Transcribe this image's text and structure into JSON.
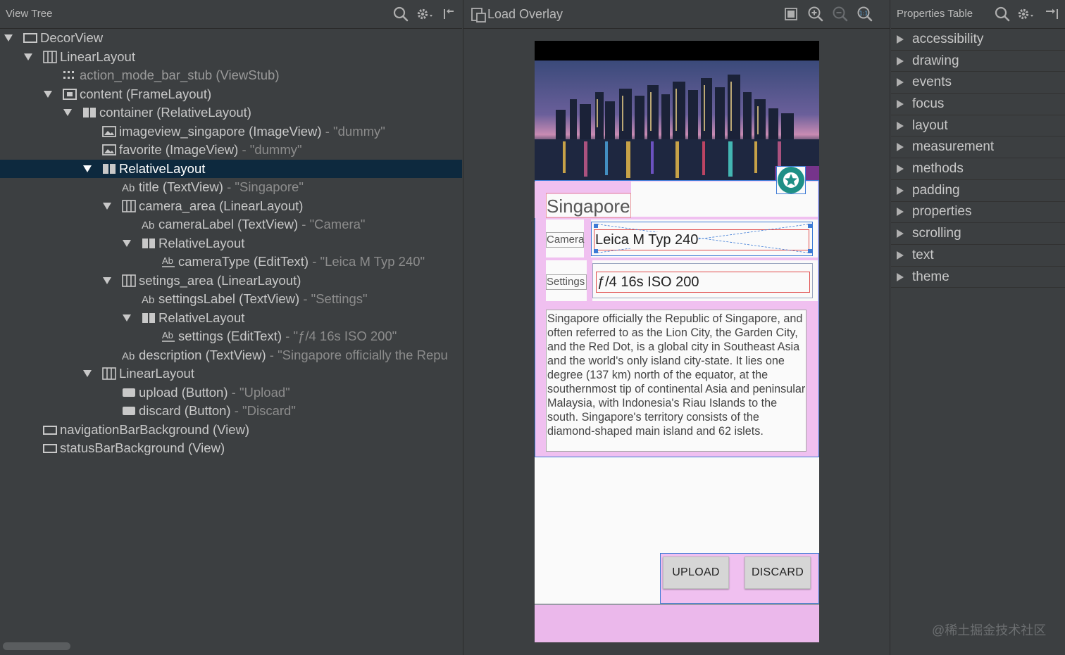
{
  "left_panel": {
    "title": "View Tree",
    "tree": [
      {
        "name": "DecorView",
        "value": "",
        "expanded": true,
        "selected": false,
        "icon": "frame-icon"
      },
      {
        "name": "LinearLayout",
        "value": "",
        "expanded": true,
        "selected": false,
        "icon": "linear-layout-icon"
      },
      {
        "name": "action_mode_bar_stub (ViewStub)",
        "value": "",
        "expanded": null,
        "selected": false,
        "icon": "viewstub-icon",
        "dim": true
      },
      {
        "name": "content (FrameLayout)",
        "value": "",
        "expanded": true,
        "selected": false,
        "icon": "framelayout-icon"
      },
      {
        "name": "container (RelativeLayout)",
        "value": "",
        "expanded": true,
        "selected": false,
        "icon": "relative-layout-icon"
      },
      {
        "name": "imageview_singapore (ImageView)",
        "value": "\"dummy\"",
        "expanded": null,
        "selected": false,
        "icon": "image-icon"
      },
      {
        "name": "favorite (ImageView)",
        "value": "\"dummy\"",
        "expanded": null,
        "selected": false,
        "icon": "image-icon"
      },
      {
        "name": "RelativeLayout",
        "value": "",
        "expanded": true,
        "selected": true,
        "icon": "relative-layout-icon"
      },
      {
        "name": "title (TextView)",
        "value": "\"Singapore\"",
        "expanded": null,
        "selected": false,
        "icon": "textview-icon"
      },
      {
        "name": "camera_area (LinearLayout)",
        "value": "",
        "expanded": true,
        "selected": false,
        "icon": "linear-layout-icon"
      },
      {
        "name": "cameraLabel (TextView)",
        "value": "\"Camera\"",
        "expanded": null,
        "selected": false,
        "icon": "textview-icon"
      },
      {
        "name": "RelativeLayout",
        "value": "",
        "expanded": true,
        "selected": false,
        "icon": "relative-layout-icon"
      },
      {
        "name": "cameraType (EditText)",
        "value": "\"Leica M Typ 240\"",
        "expanded": null,
        "selected": false,
        "icon": "edittext-icon"
      },
      {
        "name": "setings_area (LinearLayout)",
        "value": "",
        "expanded": true,
        "selected": false,
        "icon": "linear-layout-icon"
      },
      {
        "name": "settingsLabel (TextView)",
        "value": "\"Settings\"",
        "expanded": null,
        "selected": false,
        "icon": "textview-icon"
      },
      {
        "name": "RelativeLayout",
        "value": "",
        "expanded": true,
        "selected": false,
        "icon": "relative-layout-icon"
      },
      {
        "name": "settings (EditText)",
        "value": "\"ƒ/4 16s ISO 200\"",
        "expanded": null,
        "selected": false,
        "icon": "edittext-icon"
      },
      {
        "name": "description (TextView)",
        "value": "\"Singapore officially the Repu",
        "expanded": null,
        "selected": false,
        "icon": "textview-icon"
      },
      {
        "name": "LinearLayout",
        "value": "",
        "expanded": true,
        "selected": false,
        "icon": "linear-layout-icon"
      },
      {
        "name": "upload (Button)",
        "value": "\"Upload\"",
        "expanded": null,
        "selected": false,
        "icon": "button-icon"
      },
      {
        "name": "discard (Button)",
        "value": "\"Discard\"",
        "expanded": null,
        "selected": false,
        "icon": "button-icon"
      },
      {
        "name": "navigationBarBackground (View)",
        "value": "",
        "expanded": null,
        "selected": false,
        "icon": "view-icon"
      },
      {
        "name": "statusBarBackground (View)",
        "value": "",
        "expanded": null,
        "selected": false,
        "icon": "view-icon"
      }
    ]
  },
  "middle_panel": {
    "title": "Load Overlay",
    "device": {
      "title": "Singapore",
      "camera_label": "Camera",
      "camera_value": "Leica M Typ 240",
      "settings_label": "Settings",
      "settings_value": "ƒ/4 16s ISO 200",
      "description": "Singapore officially the Republic of Singapore, and often referred to as the Lion City, the Garden City, and the Red Dot, is a global city in Southeast Asia and the world's only island city-state. It lies one degree (137 km) north of the equator, at the southernmost tip of continental Asia and peninsular Malaysia, with Indonesia's Riau Islands to the south. Singapore's territory consists of the diamond-shaped main island and 62 islets.",
      "upload_label": "UPLOAD",
      "discard_label": "DISCARD"
    }
  },
  "right_panel": {
    "title": "Properties Table",
    "items": [
      "accessibility",
      "drawing",
      "events",
      "focus",
      "layout",
      "measurement",
      "methods",
      "padding",
      "properties",
      "scrolling",
      "text",
      "theme"
    ]
  },
  "watermark": "@稀土掘金技术社区",
  "colors": {
    "panel_bg": "#3c3f41",
    "selection": "#0d293e",
    "overlay_pink": "#f0c0f0",
    "bounds_blue": "#3d7bd6",
    "bounds_red": "#e04b4b",
    "fab_teal": "#1e8f86"
  }
}
